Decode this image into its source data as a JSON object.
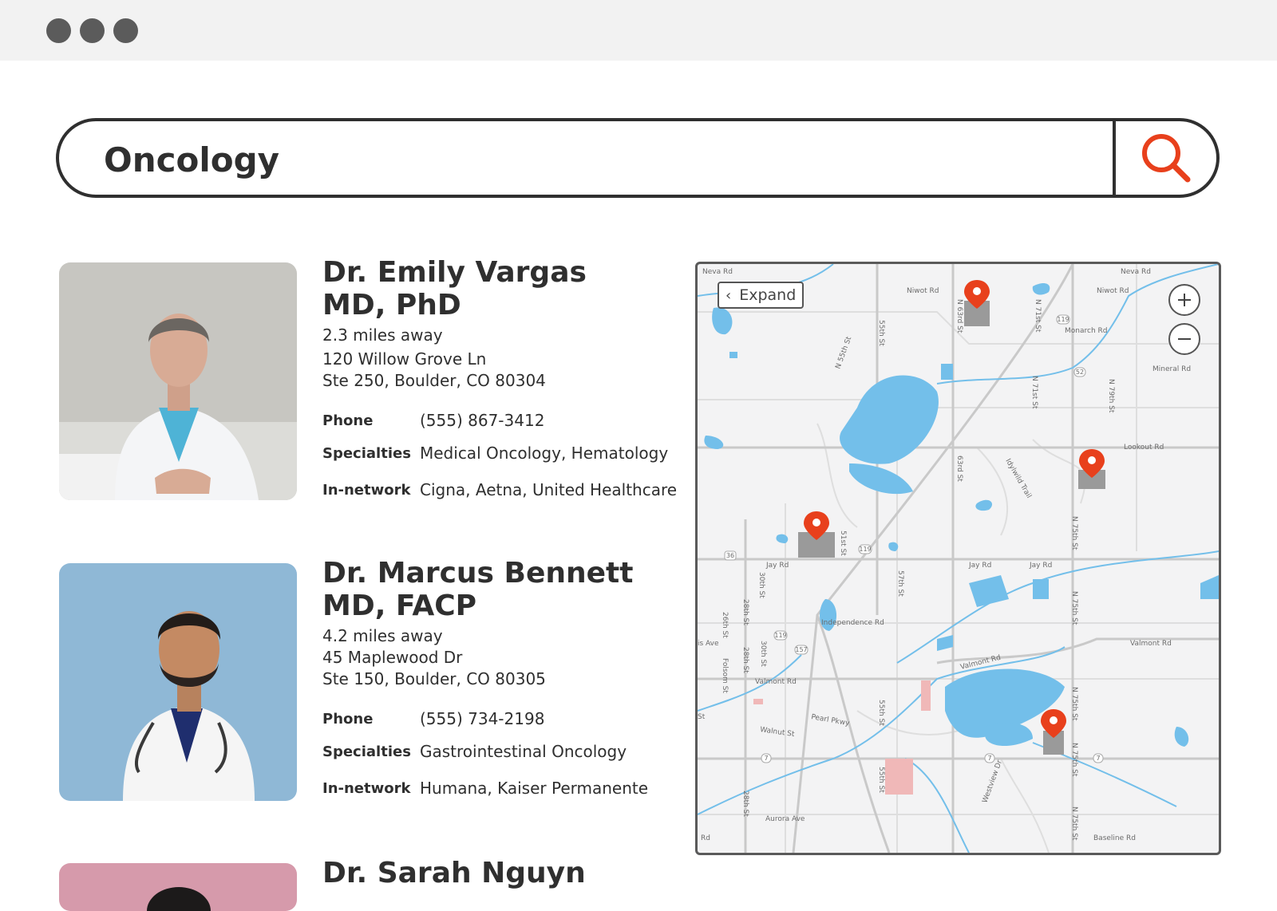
{
  "search": {
    "query": "Oncology",
    "button_icon": "search-icon",
    "accent": "#e8401c"
  },
  "doctors": [
    {
      "name": "Dr. Emily Vargas",
      "credentials": "MD, PhD",
      "distance": "2.3 miles away",
      "address_line1": "120 Willow Grove Ln",
      "address_line2": "Ste 250, Boulder, CO 80304",
      "phone_label": "Phone",
      "phone": "(555) 867-3412",
      "specialties_label": "Specialties",
      "specialties": "Medical Oncology, Hematology",
      "network_label": "In-network",
      "network": "Cigna, Aetna, United Healthcare"
    },
    {
      "name": "Dr. Marcus Bennett",
      "credentials": "MD, FACP",
      "distance": "4.2 miles away",
      "address_line1": "45 Maplewood Dr",
      "address_line2": "Ste 150, Boulder, CO 80305",
      "phone_label": "Phone",
      "phone": "(555) 734-2198",
      "specialties_label": "Specialties",
      "specialties": "Gastrointestinal Oncology",
      "network_label": "In-network",
      "network": "Humana, Kaiser Permanente"
    },
    {
      "name": "Dr. Sarah Nguyn"
    }
  ],
  "map": {
    "expand_label": "Expand",
    "zoom_in_icon": "plus-icon",
    "zoom_out_icon": "minus-icon",
    "pin_color": "#e8401c",
    "water_color": "#73bfea",
    "streets": {
      "s1": "Neva Rd",
      "s2": "Neva Rd",
      "s3": "Niwot Rd",
      "s4": "Niwot Rd",
      "s5": "Monarch Rd",
      "s6": "Mineral Rd",
      "s7": "Lookout Rd",
      "s8": "Jay Rd",
      "s9": "Jay Rd",
      "s10": "Jay Rd",
      "s11": "Independence Rd",
      "s12": "Valmont Rd",
      "s13": "Valmont Rd",
      "s14": "Valmont Rd",
      "s15": "Pearl Pkwy",
      "s16": "Walnut St",
      "s17": "Aurora Ave",
      "s18": "Baseline Rd",
      "s19": "55th St",
      "s20": "N 55th St",
      "s21": "N 63rd St",
      "s22": "N 71st St",
      "s23": "N 71st St",
      "s24": "N 79th St",
      "s25": "63rd St",
      "s26": "N 75th St",
      "s27": "51st St",
      "s28": "57th St",
      "s29": "30th St",
      "s30": "28th St",
      "s31": "26th St",
      "s32": "Folsom St",
      "s33": "30th St",
      "s34": "28th St",
      "s35": "55th St",
      "s36": "N 75th St",
      "s37": "N 75th St",
      "s38": "Westview Dr",
      "s39": "55th St",
      "s40": "28th St",
      "s41": "N 75th St",
      "s42": "N 75th St",
      "s43": "Idylwild Trail",
      "s44": "is Ave",
      "s45": "St",
      "s46": "Rd",
      "r119": "119",
      "r52": "52",
      "r36": "36",
      "r157": "157",
      "r7": "7"
    }
  }
}
